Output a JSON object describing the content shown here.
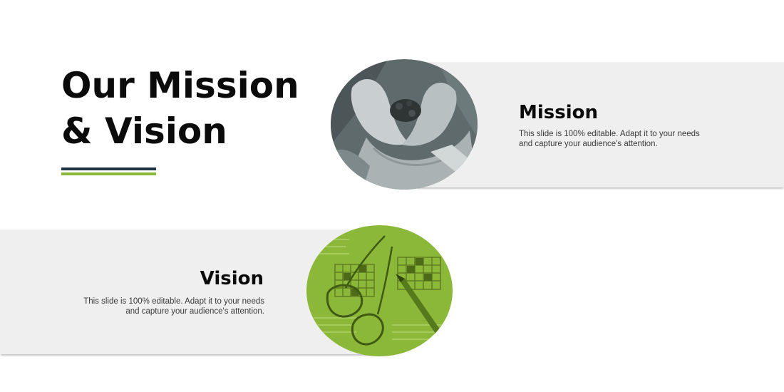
{
  "title": {
    "line1": "Our Mission",
    "line2": "& Vision"
  },
  "mission": {
    "heading": "Mission",
    "line1": "This slide is 100% editable. Adapt it to your needs",
    "line2": "and capture your audience's attention.",
    "photo_icon": "cupped-hands-soil-photo",
    "photo_tint": "#5f6a6d"
  },
  "vision": {
    "heading": "Vision",
    "line1": "This slide is 100% editable. Adapt it to your needs",
    "line2": "and capture your audience's attention.",
    "photo_icon": "glasses-pen-crossword-photo",
    "photo_tint": "#8cb83a"
  },
  "colors": {
    "title_text": "#0b0b0b",
    "rule_dark": "#1f3346",
    "rule_green": "#8cb83a",
    "band": "#efefef"
  }
}
